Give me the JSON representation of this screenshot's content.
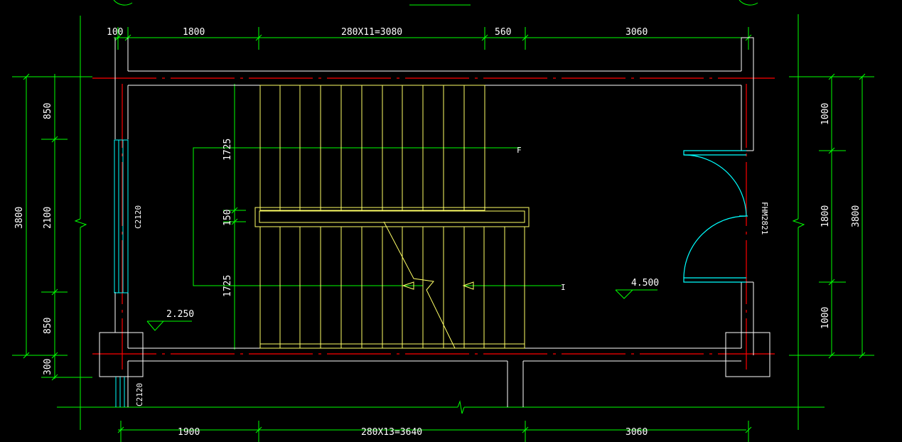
{
  "colors": {
    "background": "#000000",
    "dimension": "#00ff00",
    "wall": "#ffffff",
    "axis": "#ff0000",
    "stair": "#ffff66",
    "door": "#00ffff",
    "text": "#ffffff"
  },
  "dimensions": {
    "top": [
      "100",
      "1800",
      "280X11=3080",
      "560",
      "3060"
    ],
    "bottom": [
      "1900",
      "280X13=3640",
      "3060"
    ],
    "left_inner": [
      "850",
      "2100",
      "850",
      "300"
    ],
    "left_total": "3800",
    "right_inner": [
      "1000",
      "1800",
      "1000"
    ],
    "right_total": "3800",
    "stair_vertical": [
      "1725",
      "150",
      "1725"
    ]
  },
  "labels": {
    "window_top": "C2120",
    "window_bottom": "C2120",
    "door": "FHM2821",
    "level_low": "2.250",
    "level_high": "4.500",
    "stair_up_marker": "F",
    "stair_down_marker": "I"
  },
  "icons": [
    "elevation-marker-icon",
    "break-line-icon",
    "stair-arrow-icon",
    "door-swing-icon"
  ]
}
